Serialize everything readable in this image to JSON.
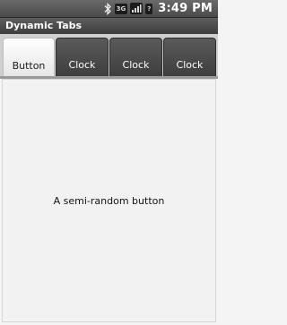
{
  "status_bar": {
    "icons": [
      "bluetooth-icon",
      "3g-icon",
      "signal-icon",
      "battery-icon"
    ],
    "network_label": "3G",
    "battery_label": "?",
    "time": "3:49 PM"
  },
  "app": {
    "title": "Dynamic Tabs"
  },
  "tabs": [
    {
      "label": "Button",
      "selected": true
    },
    {
      "label": "Clock",
      "selected": false
    },
    {
      "label": "Clock",
      "selected": false
    },
    {
      "label": "Clock",
      "selected": false
    }
  ],
  "content": {
    "button_label": "A semi-random button"
  },
  "colors": {
    "status_bar": "#4a4a4a",
    "title_bar": "#444444",
    "tab_inactive": "#454545",
    "tab_active": "#f4f4f4",
    "content_bg": "#f2f2f2"
  }
}
